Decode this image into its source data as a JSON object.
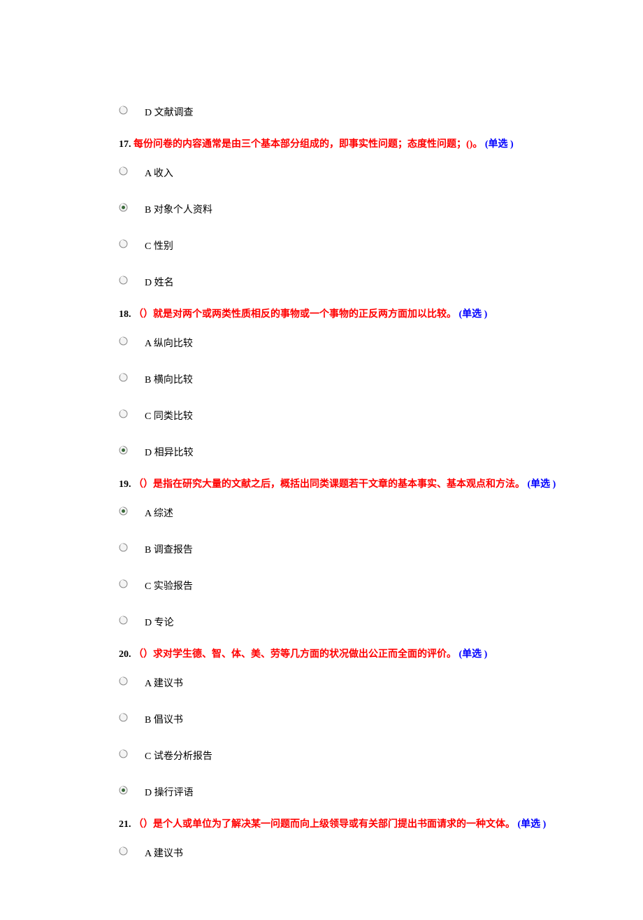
{
  "orphan_option": {
    "text": "D 文献调查"
  },
  "questions": [
    {
      "num": "17.",
      "text": "每份问卷的内容通常是由三个基本部分组成的，即事实性问题；态度性问题；()。",
      "type": "(单选 )",
      "options": [
        {
          "text": "A 收入",
          "selected": false
        },
        {
          "text": "B 对象个人资料",
          "selected": true
        },
        {
          "text": "C 性别",
          "selected": false
        },
        {
          "text": "D 姓名",
          "selected": false
        }
      ]
    },
    {
      "num": "18.",
      "text": "（）就是对两个或两类性质相反的事物或一个事物的正反两方面加以比较。",
      "type": "(单选 )",
      "options": [
        {
          "text": "A 纵向比较",
          "selected": false
        },
        {
          "text": "B 横向比较",
          "selected": false
        },
        {
          "text": "C 同类比较",
          "selected": false
        },
        {
          "text": "D 相异比较",
          "selected": true
        }
      ]
    },
    {
      "num": "19.",
      "text": "（）是指在研究大量的文献之后，概括出同类课题若干文章的基本事实、基本观点和方法。",
      "type": "(单选 )",
      "options": [
        {
          "text": "A 综述",
          "selected": true
        },
        {
          "text": "B 调查报告",
          "selected": false
        },
        {
          "text": "C 实验报告",
          "selected": false
        },
        {
          "text": "D 专论",
          "selected": false
        }
      ]
    },
    {
      "num": "20.",
      "text": "（）求对学生德、智、体、美、劳等几方面的状况做出公正而全面的评价。",
      "type": "(单选 )",
      "options": [
        {
          "text": "A 建议书",
          "selected": false
        },
        {
          "text": "B 倡议书",
          "selected": false
        },
        {
          "text": "C 试卷分析报告",
          "selected": false
        },
        {
          "text": "D 操行评语",
          "selected": true
        }
      ]
    },
    {
      "num": "21.",
      "text": "（）是个人或单位为了解决某一问题而向上级领导或有关部门提出书面请求的一种文体。",
      "type": "(单选 )",
      "options": [
        {
          "text": "A 建议书",
          "selected": false
        }
      ]
    }
  ],
  "radio_svg": {
    "unselected": "<svg width='13' height='13' viewBox='0 0 13 13'><circle cx='6.5' cy='6.5' r='5.5' fill='#f4f4f4' stroke='#8a8a8a' stroke-width='1'/><path d='M2.5 3.5 A5 5 0 0 1 6.5 1.5' stroke='#ffffff' stroke-width='1' fill='none'/></svg>",
    "selected": "<svg width='13' height='13' viewBox='0 0 13 13'><circle cx='6.5' cy='6.5' r='5.5' fill='#f4f4f4' stroke='#8a8a8a' stroke-width='1'/><circle cx='6.5' cy='6.5' r='2.5' fill='#3a6a3a'/><path d='M2.5 3.5 A5 5 0 0 1 6.5 1.5' stroke='#ffffff' stroke-width='1' fill='none'/></svg>"
  }
}
